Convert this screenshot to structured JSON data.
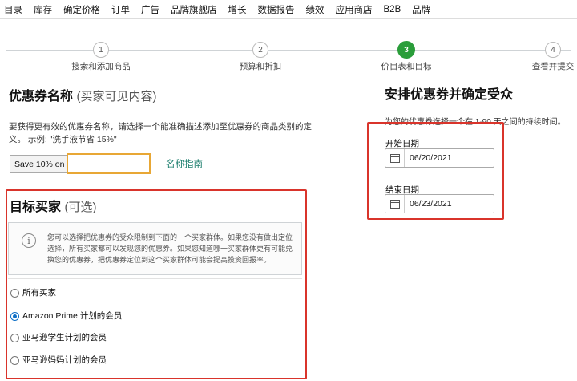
{
  "nav": {
    "items": [
      "目录",
      "库存",
      "确定价格",
      "订单",
      "广告",
      "品牌旗舰店",
      "增长",
      "数据报告",
      "绩效",
      "应用商店",
      "B2B",
      "品牌"
    ]
  },
  "stepper": {
    "steps": [
      {
        "number": "1",
        "label": "搜索和添加商品"
      },
      {
        "number": "2",
        "label": "预算和折扣"
      },
      {
        "number": "3",
        "label": "价目表和目标"
      },
      {
        "number": "4",
        "label": "查看并提交"
      }
    ],
    "active_step": 3,
    "accent_color": "#2a9d3a"
  },
  "coupon_name": {
    "title": "优惠券名称",
    "title_note": "(买家可见内容)",
    "hint": "要获得更有效的优惠券名称，请选择一个能准确描述添加至优惠券的商品类别的定义。 示例: \"洗手液节省 15%\"",
    "prefix": "Save 10% on",
    "input_value": "",
    "input_placeholder": "",
    "guide_link": "名称指南"
  },
  "target_buyers": {
    "title": "目标买家",
    "title_note": "(可选)",
    "info_text": "您可以选择把优惠券的受众限制到下面的一个买家群体。如果您没有做出定位选择，所有买家都可以发现您的优惠券。如果您知道哪一买家群体更有可能兑换您的优惠券，把优惠券定位到这个买家群体可能会提高投资回报率。",
    "options": [
      {
        "label": "所有买家",
        "checked": false
      },
      {
        "label": "Amazon Prime 计划的会员",
        "checked": true
      },
      {
        "label": "亚马逊学生计划的会员",
        "checked": false
      },
      {
        "label": "亚马逊妈妈计划的会员",
        "checked": false
      }
    ],
    "highlight_color": "#d9342b"
  },
  "schedule": {
    "title": "安排优惠券并确定受众",
    "hint": "为您的优惠券选择一个在 1-90 天之间的持续时间。",
    "start_label": "开始日期",
    "start_value": "06/20/2021",
    "end_label": "结束日期",
    "end_value": "06/23/2021"
  }
}
